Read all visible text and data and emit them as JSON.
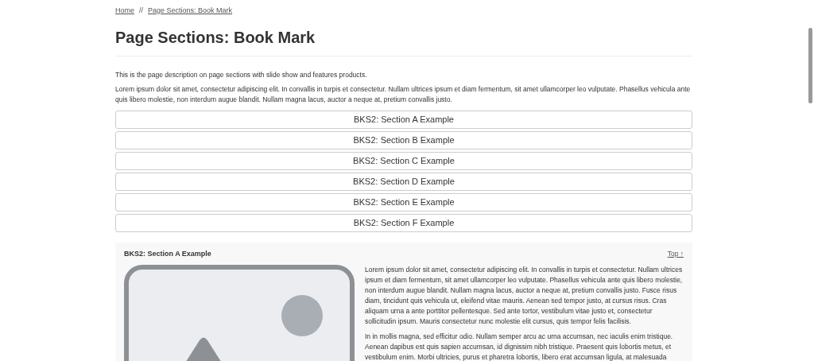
{
  "breadcrumb": [
    {
      "label": "Home"
    },
    {
      "label": "Page Sections: Book Mark"
    }
  ],
  "breadcrumb_separator": "//",
  "title": "Page Sections: Book Mark",
  "description": "This is the page description on page sections with slide show and features products.",
  "intro": "Lorem ipsum dolor sit amet, consectetur adipiscing elit. In convallis in turpis et consectetur. Nullam ultrices ipsum et diam fermentum, sit amet ullamcorper leo vulputate. Phasellus vehicula ante quis libero molestie, non interdum augue blandit. Nullam magna lacus, auctor a neque at, pretium convallis justo.",
  "bookmarks": [
    {
      "label": "BKS2: Section A Example"
    },
    {
      "label": "BKS2: Section B Example"
    },
    {
      "label": "BKS2: Section C Example"
    },
    {
      "label": "BKS2: Section D Example"
    },
    {
      "label": "BKS2: Section E Example"
    },
    {
      "label": "BKS2: Section F Example"
    }
  ],
  "section": {
    "heading": "BKS2: Section A Example",
    "top_link": "Top ↑",
    "paragraphs": [
      "Lorem ipsum dolor sit amet, consectetur adipiscing elit. In convallis in turpis et consectetur. Nullam ultrices ipsum et diam fermentum, sit amet ullamcorper leo vulputate. Phasellus vehicula ante quis libero molestie, non interdum augue blandit. Nullam magna lacus, auctor a neque at, pretium convallis justo. Fusce risus diam, tincidunt quis vehicula ut, eleifend vitae mauris. Aenean sed tempor justo, at cursus risus. Cras aliquam urna a ante porttitor pellentesque. Sed ante tortor, vestibulum vitae justo et, consectetur sollicitudin ipsum. Mauris consectetur nunc molestie elit cursus, quis tempor felis facilisis.",
      "In in mollis magna, sed efficitur odio. Nullam semper arcu ac urna accumsan, nec iaculis enim tristique. Aenean dapibus est quis sapien accumsan, id dignissim nibh tristique. Praesent quis lobortis metus, et vestibulum enim. Morbi ultricies, purus et pharetra lobortis, libero erat accumsan ligula, at malesuada"
    ]
  }
}
